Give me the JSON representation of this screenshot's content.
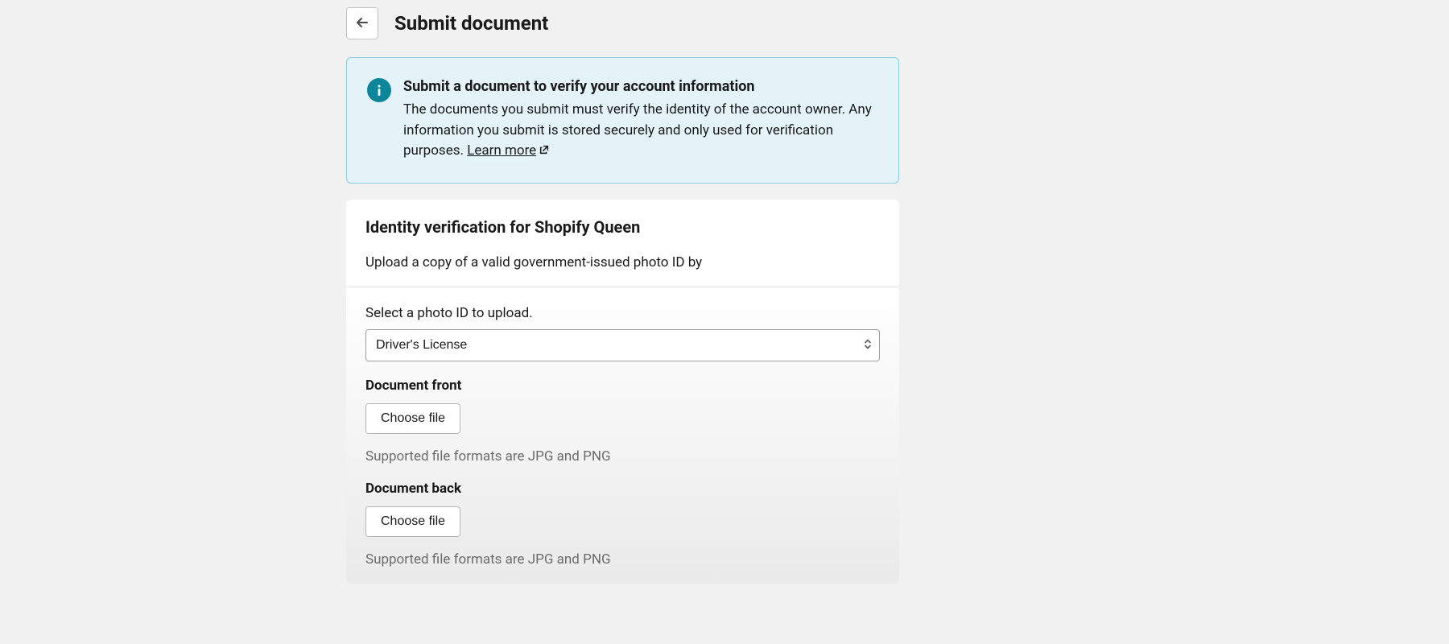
{
  "header": {
    "title": "Submit document"
  },
  "banner": {
    "title": "Submit a document to verify your account information",
    "body": "The documents you submit must verify the identity of the account owner. Any information you submit is stored securely and only used for verification purposes. ",
    "learn_more": "Learn more"
  },
  "verification": {
    "title": "Identity verification for Shopify Queen",
    "subtitle": "Upload a copy of a valid government-issued photo ID by"
  },
  "upload": {
    "select_label": "Select a photo ID to upload.",
    "select_value": "Driver's License",
    "front_label": "Document front",
    "back_label": "Document back",
    "choose_file": "Choose file",
    "hint": "Supported file formats are JPG and PNG"
  }
}
